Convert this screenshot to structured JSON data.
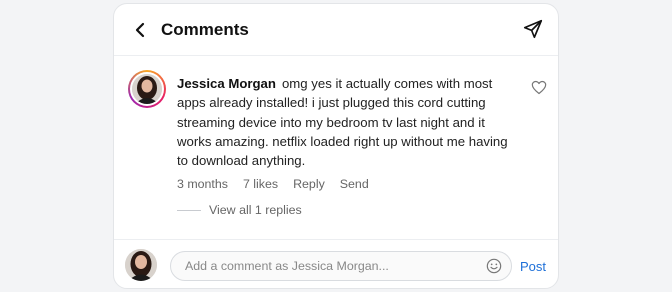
{
  "header": {
    "title": "Comments",
    "back_icon": "chevron-left-icon",
    "send_icon": "paper-plane-icon"
  },
  "comment": {
    "author": "Jessica Morgan",
    "text": "omg yes it actually comes with most apps already installed! i just plugged this cord cutting streaming device into my bedroom tv last night and it works amazing. netflix loaded right up without me having to download anything.",
    "time": "3 months",
    "likes": "7 likes",
    "reply_label": "Reply",
    "send_label": "Send",
    "like_icon": "heart-icon"
  },
  "replies": {
    "label": "View all 1 replies"
  },
  "composer": {
    "placeholder": "Add a comment as Jessica Morgan...",
    "post_label": "Post",
    "emoji_icon": "smiley-icon"
  },
  "colors": {
    "accent": "#1d6fd8",
    "avatar_ring": [
      "#f9a825",
      "#e91e63",
      "#9c27b0"
    ]
  }
}
